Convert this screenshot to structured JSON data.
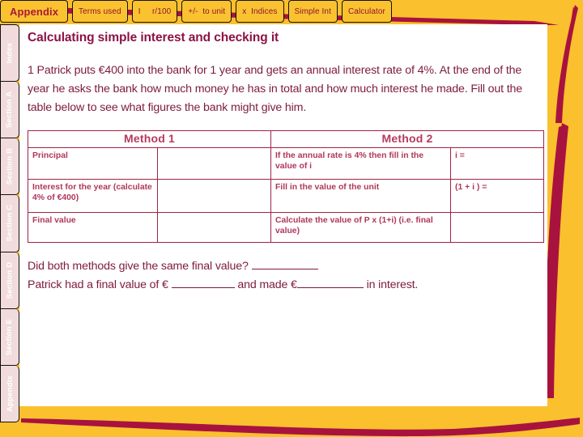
{
  "theme": {
    "gold": "#FBC02D",
    "maroon": "#9E1B3F",
    "text_maroon": "#7E1B3C",
    "title_maroon": "#8C1245",
    "table_border": "#9E2346",
    "tab_pink": "#F2DBDC"
  },
  "top_tabs": [
    {
      "label": "Appendix",
      "active": true
    },
    {
      "label": "Terms used",
      "active": false
    },
    {
      "label": "I     r/100",
      "active": false
    },
    {
      "label": "+/-  to unit",
      "active": false
    },
    {
      "label": "x  Indices",
      "active": false
    },
    {
      "label": "Simple Int",
      "active": false
    },
    {
      "label": "Calculator",
      "active": false
    }
  ],
  "side_tabs": [
    {
      "label": "Index"
    },
    {
      "label": "Section A"
    },
    {
      "label": "Section B"
    },
    {
      "label": "Section C"
    },
    {
      "label": "Section D"
    },
    {
      "label": "Section E"
    },
    {
      "label": "Appendix"
    }
  ],
  "page": {
    "title": "Calculating simple interest and checking it",
    "intro": "1 Patrick puts €400 into the bank for 1 year and gets an annual interest rate of 4%. At the end of the year he asks the bank how much money he has in total and how much interest he made. Fill out the table below to see what figures the bank might give him."
  },
  "worksheet": {
    "headers": [
      "Method 1",
      "Method 2"
    ],
    "rows": [
      {
        "m1_label": "Principal",
        "m1_answer": "",
        "m2_label": "If the annual rate is 4% then fill in the value of i",
        "m2_answer": "i ="
      },
      {
        "m1_label": "Interest for the year (calculate 4% of €400)",
        "m1_answer": "",
        "m2_label": "Fill in the value of the unit",
        "m2_answer": "(1 + i ) ="
      },
      {
        "m1_label": "Final value",
        "m1_answer": "",
        "m2_label": "Calculate the value of P x (1+i) (i.e. final value)",
        "m2_answer": ""
      }
    ]
  },
  "closing": {
    "q1": "Did both methods give the same final value?",
    "q2_a": "Patrick had a final value of €",
    "q2_b": "and made €",
    "q2_c": "in interest."
  }
}
